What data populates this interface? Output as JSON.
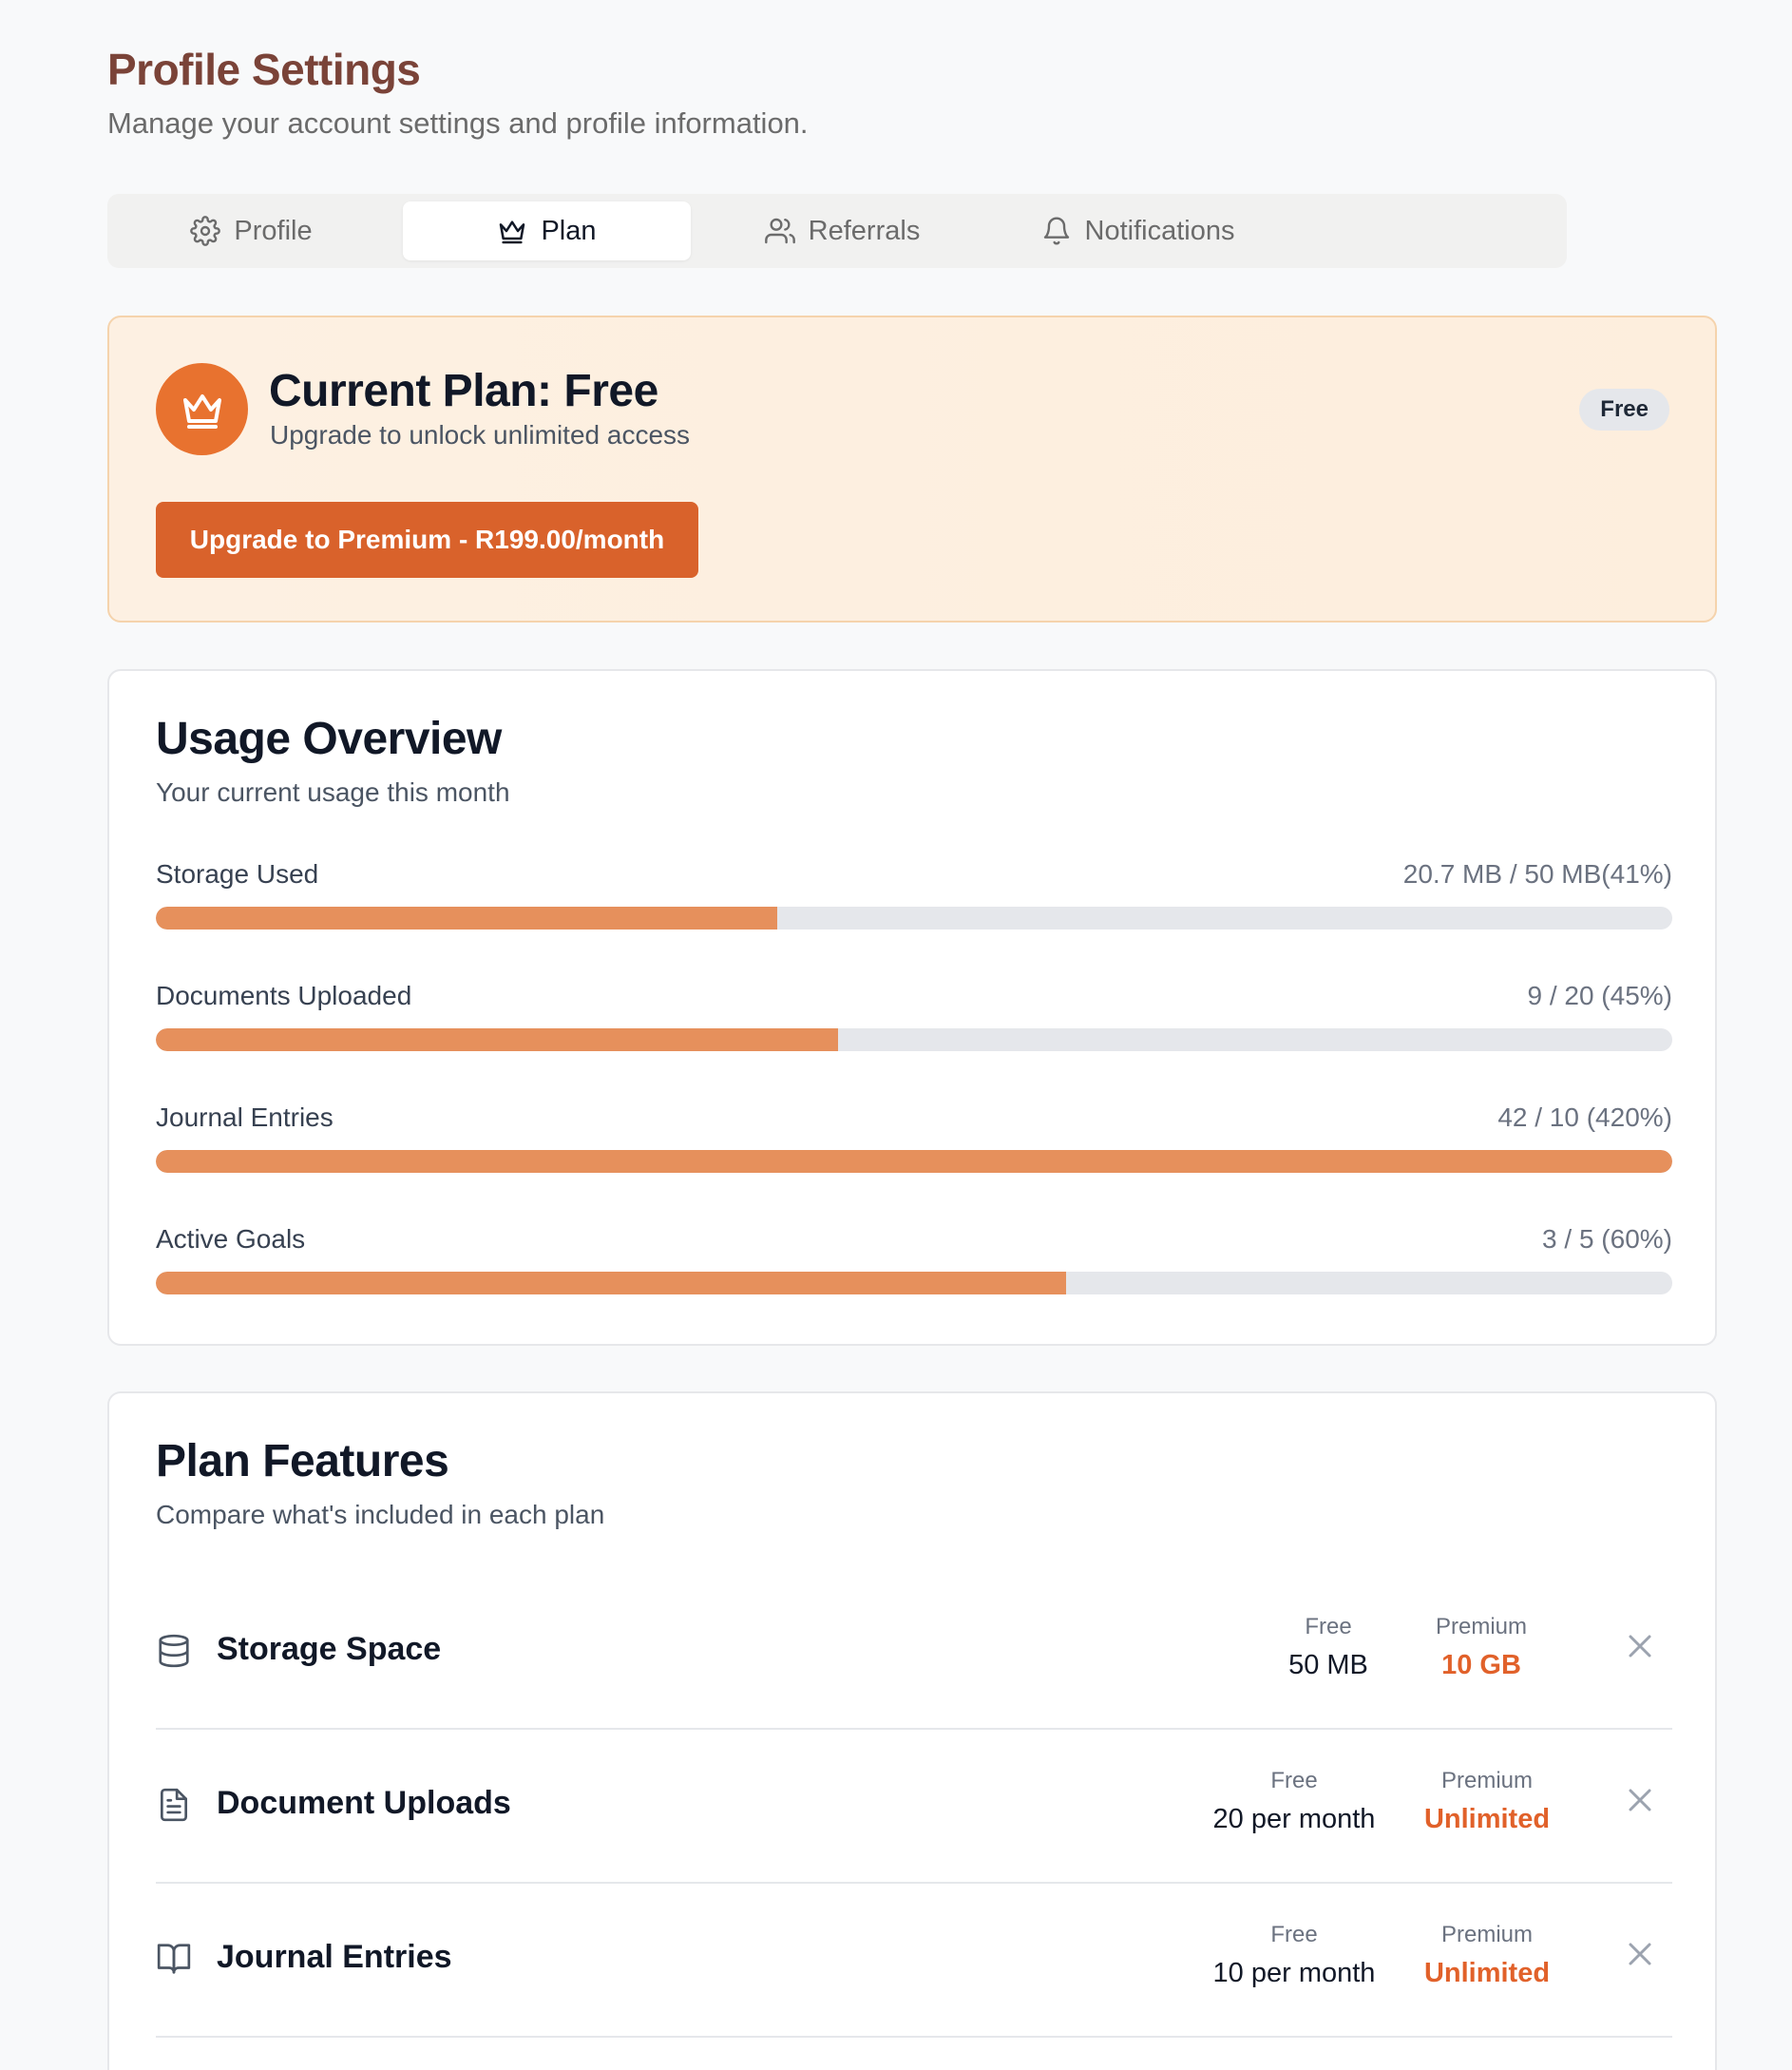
{
  "header": {
    "title": "Profile Settings",
    "subtitle": "Manage your account settings and profile information."
  },
  "tabs": [
    {
      "label": "Profile",
      "icon": "gear-icon",
      "active": false
    },
    {
      "label": "Plan",
      "icon": "crown-icon",
      "active": true
    },
    {
      "label": "Referrals",
      "icon": "users-icon",
      "active": false
    },
    {
      "label": "Notifications",
      "icon": "bell-icon",
      "active": false
    }
  ],
  "current_plan": {
    "title": "Current Plan: Free",
    "subtitle": "Upgrade to unlock unlimited access",
    "badge": "Free",
    "upgrade_button": "Upgrade to Premium - R199.00/month",
    "icon": "crown-icon",
    "accent": "#d9622b"
  },
  "usage": {
    "title": "Usage Overview",
    "subtitle": "Your current usage this month",
    "items": [
      {
        "label": "Storage Used",
        "value": "20.7 MB / 50 MB(41%)",
        "percent": 41
      },
      {
        "label": "Documents Uploaded",
        "value": "9 / 20 (45%)",
        "percent": 45
      },
      {
        "label": "Journal Entries",
        "value": "42 / 10 (420%)",
        "percent": 100
      },
      {
        "label": "Active Goals",
        "value": "3 / 5 (60%)",
        "percent": 60
      }
    ]
  },
  "features": {
    "title": "Plan Features",
    "subtitle": "Compare what's included in each plan",
    "free_label": "Free",
    "premium_label": "Premium",
    "rows": [
      {
        "name": "Storage Space",
        "icon": "database-icon",
        "free": "50 MB",
        "premium": "10 GB"
      },
      {
        "name": "Document Uploads",
        "icon": "file-text-icon",
        "free": "20 per month",
        "premium": "Unlimited"
      },
      {
        "name": "Journal Entries",
        "icon": "book-open-icon",
        "free": "10 per month",
        "premium": "Unlimited"
      }
    ]
  }
}
